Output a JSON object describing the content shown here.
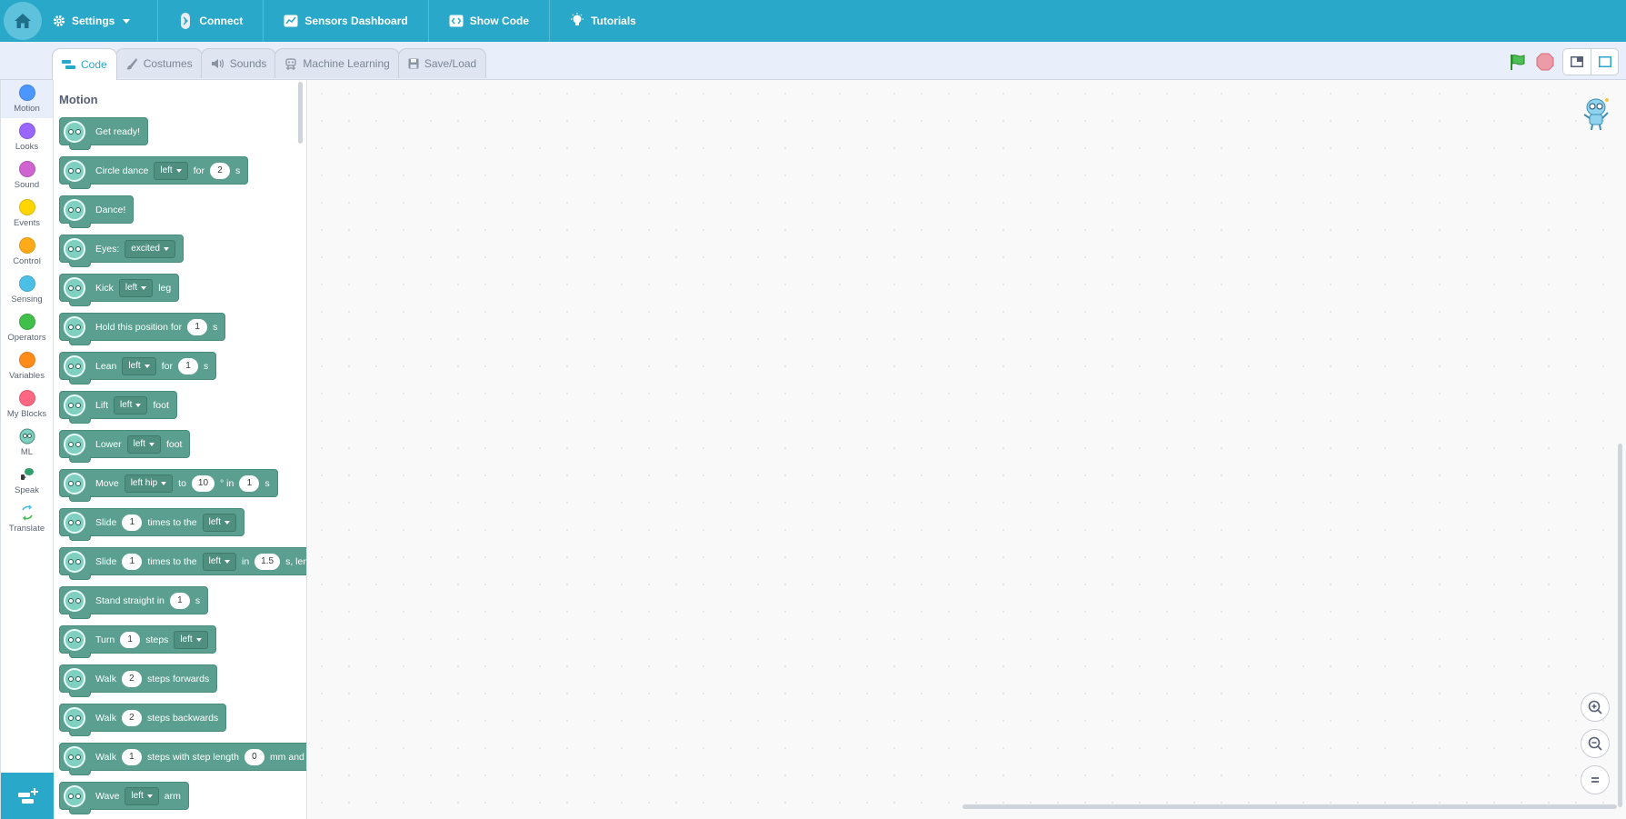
{
  "menubar": {
    "settings": "Settings",
    "connect": "Connect",
    "sensors_dashboard": "Sensors Dashboard",
    "show_code": "Show Code",
    "tutorials": "Tutorials",
    "bg_color": "#2aa8c9"
  },
  "tabs": {
    "code": "Code",
    "costumes": "Costumes",
    "sounds": "Sounds",
    "machine_learning": "Machine Learning",
    "save_load": "Save/Load"
  },
  "categories": [
    {
      "label": "Motion",
      "color": "#4c97ff"
    },
    {
      "label": "Looks",
      "color": "#9966ff"
    },
    {
      "label": "Sound",
      "color": "#cf63cf"
    },
    {
      "label": "Events",
      "color": "#ffd500"
    },
    {
      "label": "Control",
      "color": "#ffab19"
    },
    {
      "label": "Sensing",
      "color": "#4cbfe6"
    },
    {
      "label": "Operators",
      "color": "#40bf4a"
    },
    {
      "label": "Variables",
      "color": "#ff8c1a"
    },
    {
      "label": "My Blocks",
      "color": "#ff6680"
    },
    {
      "label": "ML"
    },
    {
      "label": "Speak"
    },
    {
      "label": "Translate"
    }
  ],
  "palette": {
    "heading": "Motion",
    "block_color": "#5a9f8f",
    "blocks": {
      "get_ready": {
        "t1": "Get ready!"
      },
      "circle_dance": {
        "t1": "Circle dance",
        "dd1": "left",
        "t2": "for",
        "v1": "2",
        "t3": "s"
      },
      "dance": {
        "t1": "Dance!"
      },
      "eyes": {
        "t1": "Eyes:",
        "dd1": "excited"
      },
      "kick": {
        "t1": "Kick",
        "dd1": "left",
        "t2": "leg"
      },
      "hold": {
        "t1": "Hold this position for",
        "v1": "1",
        "t2": "s"
      },
      "lean": {
        "t1": "Lean",
        "dd1": "left",
        "t2": "for",
        "v1": "1",
        "t3": "s"
      },
      "lift": {
        "t1": "Lift",
        "dd1": "left",
        "t2": "foot"
      },
      "lower": {
        "t1": "Lower",
        "dd1": "left",
        "t2": "foot"
      },
      "move": {
        "t1": "Move",
        "dd1": "left hip",
        "t2": "to",
        "v1": "10",
        "t3": "° in",
        "v2": "1",
        "t4": "s"
      },
      "slide1": {
        "t1": "Slide",
        "v1": "1",
        "t2": "times to the",
        "dd1": "left"
      },
      "slide2": {
        "t1": "Slide",
        "v1": "1",
        "t2": "times to the",
        "dd1": "left",
        "t3": "in",
        "v2": "1.5",
        "t4": "s, len"
      },
      "stand": {
        "t1": "Stand straight in",
        "v1": "1",
        "t2": "s"
      },
      "turn": {
        "t1": "Turn",
        "v1": "1",
        "t2": "steps",
        "dd1": "left"
      },
      "walk_fwd": {
        "t1": "Walk",
        "v1": "2",
        "t2": "steps forwards"
      },
      "walk_back": {
        "t1": "Walk",
        "v1": "2",
        "t2": "steps backwards"
      },
      "walk_len": {
        "t1": "Walk",
        "v1": "1",
        "t2": "steps with step length",
        "v2": "0",
        "t3": "mm and"
      },
      "wave": {
        "t1": "Wave",
        "dd1": "left",
        "t2": "arm"
      }
    }
  }
}
